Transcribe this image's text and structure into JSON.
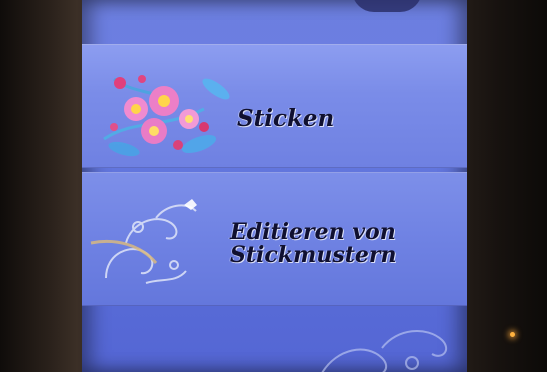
{
  "device": {
    "screen_background": "#6a7de2",
    "indicator_light_color": "#ffb23f"
  },
  "menu": {
    "items": [
      {
        "label": "Sticken",
        "icon": "flower-bouquet-icon"
      },
      {
        "label_line1": "Editieren von",
        "label_line2": "Stickmustern",
        "icon": "swirl-ornament-icon"
      }
    ]
  }
}
